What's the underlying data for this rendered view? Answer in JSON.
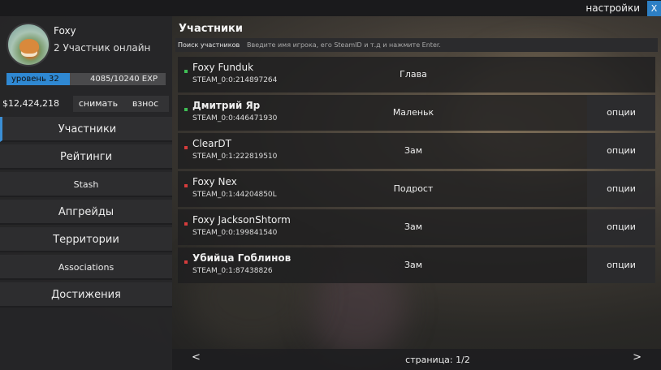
{
  "topbar": {
    "settings_label": "настройки",
    "close_label": "X"
  },
  "profile": {
    "gang_name": "Foxy",
    "members_online": "2 Участник онлайн",
    "level_label": "уровень 32",
    "exp_label": "4085/10240 EXP",
    "exp_fraction": 0.399
  },
  "bank": {
    "amount": "$12,424,218",
    "withdraw_label": "снимать",
    "deposit_label": "взнос"
  },
  "nav": [
    {
      "label": "Участники",
      "active": true
    },
    {
      "label": "Рейтинги",
      "active": false
    },
    {
      "label": "Stash",
      "active": false
    },
    {
      "label": "Апгрейды",
      "active": false
    },
    {
      "label": "Территории",
      "active": false
    },
    {
      "label": "Associations",
      "active": false
    },
    {
      "label": "Достижения",
      "active": false
    }
  ],
  "main": {
    "title": "Участники",
    "search_label": "Поиск участников",
    "search_placeholder": "Введите имя игрока, его SteamID и т.д и нажмите Enter.",
    "members": [
      {
        "name": "Foxy Funduk",
        "steam_id": "STEAM_0:0:214897264",
        "rank": "Глава",
        "status": "online",
        "options": ""
      },
      {
        "name": "Дмитрий Яр",
        "steam_id": "STEAM_0:0:446471930",
        "rank": "Маленьк",
        "status": "online",
        "options": "опции"
      },
      {
        "name": "ClearDT",
        "steam_id": "STEAM_0:1:222819510",
        "rank": "Зам",
        "status": "offline",
        "options": "опции"
      },
      {
        "name": "Foxy Nex",
        "steam_id": "STEAM_0:1:44204850L",
        "rank": "Подрост",
        "status": "offline",
        "options": "опции"
      },
      {
        "name": "Foxy JacksonShtorm",
        "steam_id": "STEAM_0:0:199841540",
        "rank": "Зам",
        "status": "offline",
        "options": "опции"
      },
      {
        "name": "Убийца Гоблинов",
        "steam_id": "STEAM_0:1:87438826",
        "rank": "Зам",
        "status": "offline",
        "options": "опции"
      }
    ],
    "pager": {
      "prev": "<",
      "next": ">",
      "page_label": "страница: 1/2"
    }
  }
}
